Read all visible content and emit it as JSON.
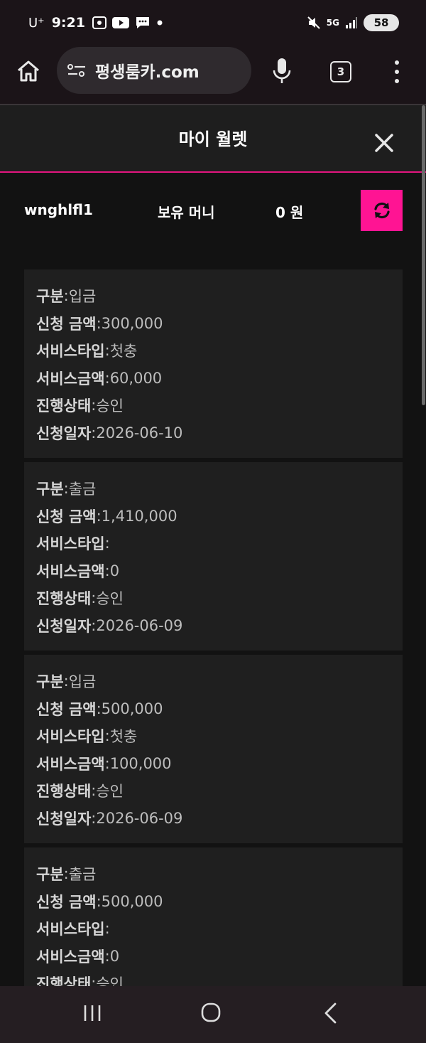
{
  "status_bar": {
    "carrier": "U⁺",
    "time": "9:21",
    "network": "5G",
    "battery": "58"
  },
  "browser": {
    "url": "평생룸카.com",
    "tab_count": "3"
  },
  "modal": {
    "title": "마이 월렛"
  },
  "wallet": {
    "user_id": "wnghlfl1",
    "money_label": "보유 머니",
    "money_value": "0 원"
  },
  "labels": {
    "category": "구분",
    "request_amount": "신청 금액",
    "service_type": "서비스타입",
    "service_amount": "서비스금액",
    "status": "진행상태",
    "request_date": "신청일자"
  },
  "transactions": [
    {
      "category": " 입금",
      "request_amount": " 300,000",
      "service_type": "첫충",
      "service_amount": "60,000",
      "status": "승인",
      "request_date": "2026-06-10"
    },
    {
      "category": " 출금",
      "request_amount": " 1,410,000",
      "service_type": "",
      "service_amount": "0",
      "status": "승인",
      "request_date": "2026-06-09"
    },
    {
      "category": " 입금",
      "request_amount": " 500,000",
      "service_type": "첫충",
      "service_amount": "100,000",
      "status": "승인",
      "request_date": "2026-06-09"
    },
    {
      "category": " 출금",
      "request_amount": " 500,000",
      "service_type": "",
      "service_amount": "0",
      "status": "승인",
      "request_date": ""
    }
  ],
  "colors": {
    "accent": "#ff1493",
    "header_border": "#e3157f",
    "card_bg": "#1f1f1f",
    "page_bg": "#121212"
  },
  "icons": {
    "home": "home-icon",
    "site_info": "site-settings-icon",
    "mic": "microphone-icon",
    "close": "close-icon",
    "refresh": "refresh-icon"
  }
}
